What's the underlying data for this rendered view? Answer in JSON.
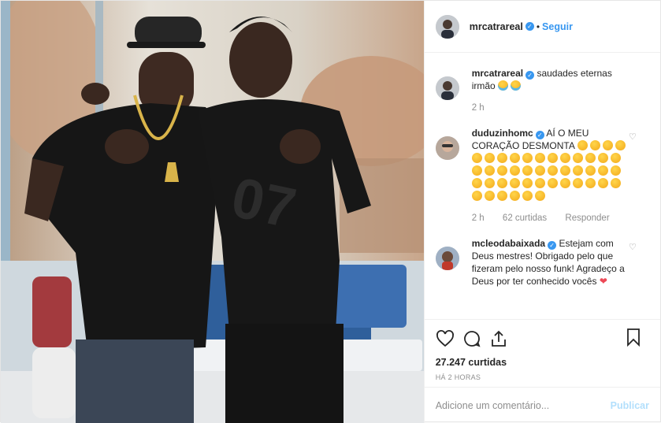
{
  "header": {
    "username": "mrcatrareal",
    "separator": "•",
    "follow_label": "Seguir"
  },
  "comments": [
    {
      "username": "mrcatrareal",
      "text": "saudades eternas irmão",
      "emoji_count": 2,
      "emoji_kind": "crying-face",
      "time": "2 h"
    },
    {
      "username": "duduzinhomc",
      "text": "AÍ O MEU CORAÇÃO DESMONTA",
      "emoji_count": 46,
      "emoji_kind": "sad-face",
      "time": "2 h",
      "likes": "62 curtidas",
      "reply_label": "Responder"
    },
    {
      "username": "mcleodabaixada",
      "text": "Estejam com Deus mestres! Obrigado pelo que fizeram pelo nosso funk! Agradeço a Deus por ter conhecido vocês",
      "emoji_kind": "heart"
    }
  ],
  "post": {
    "likes": "27.247 curtidas",
    "time_ago": "HÁ 2 HORAS"
  },
  "comment_box": {
    "placeholder": "Adicione um comentário...",
    "publish_label": "Publicar"
  },
  "colors": {
    "accent": "#3897f0",
    "muted": "#8e8e8e",
    "publish_disabled": "#b2dffc",
    "heart": "#ed4956"
  }
}
